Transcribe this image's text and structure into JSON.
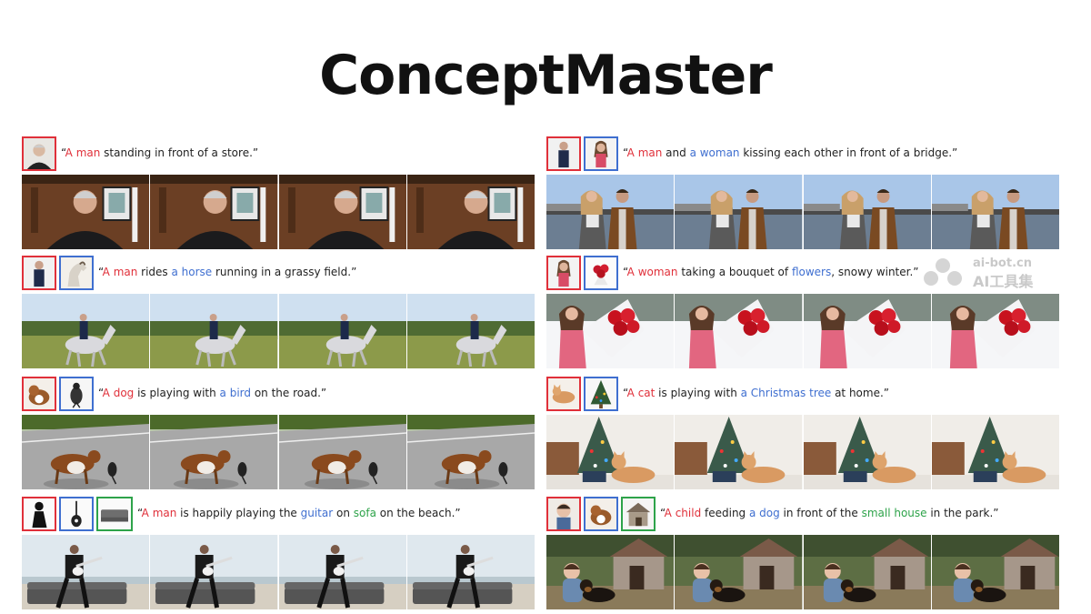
{
  "title": "ConceptMaster",
  "watermark": {
    "line1": "ai-bot.cn",
    "line2": "AI工具集"
  },
  "examples": [
    {
      "refs": [
        "man-portrait-icon"
      ],
      "caption": [
        {
          "t": "“",
          "c": ""
        },
        {
          "t": "A man",
          "c": "r"
        },
        {
          "t": " standing in front of a store.”",
          "c": ""
        }
      ],
      "scene": "store-man"
    },
    {
      "refs": [
        "man-icon",
        "horse-icon"
      ],
      "caption": [
        {
          "t": "“",
          "c": ""
        },
        {
          "t": "A man",
          "c": "r"
        },
        {
          "t": " rides ",
          "c": ""
        },
        {
          "t": "a horse",
          "c": "b"
        },
        {
          "t": " running in a grassy field.”",
          "c": ""
        }
      ],
      "scene": "horse"
    },
    {
      "refs": [
        "dog-icon",
        "bird-icon"
      ],
      "caption": [
        {
          "t": "“",
          "c": ""
        },
        {
          "t": "A dog",
          "c": "r"
        },
        {
          "t": " is playing with ",
          "c": ""
        },
        {
          "t": "a bird",
          "c": "b"
        },
        {
          "t": " on the road.”",
          "c": ""
        }
      ],
      "scene": "dog-road"
    },
    {
      "refs": [
        "man-silhouette-icon",
        "guitar-icon",
        "sofa-icon"
      ],
      "caption": [
        {
          "t": "“",
          "c": ""
        },
        {
          "t": "A man",
          "c": "r"
        },
        {
          "t": " is happily playing the ",
          "c": ""
        },
        {
          "t": "guitar",
          "c": "b"
        },
        {
          "t": " on ",
          "c": ""
        },
        {
          "t": "sofa",
          "c": "g"
        },
        {
          "t": " on the beach.”",
          "c": ""
        }
      ],
      "scene": "beach-guitar"
    },
    {
      "refs": [
        "man-icon",
        "woman-icon"
      ],
      "caption": [
        {
          "t": "“",
          "c": ""
        },
        {
          "t": "A man",
          "c": "r"
        },
        {
          "t": " and ",
          "c": ""
        },
        {
          "t": "a woman",
          "c": "b"
        },
        {
          "t": " kissing each other in front of a bridge.”",
          "c": ""
        }
      ],
      "scene": "bridge-couple"
    },
    {
      "refs": [
        "woman-icon",
        "flowers-icon"
      ],
      "caption": [
        {
          "t": "“",
          "c": ""
        },
        {
          "t": "A woman",
          "c": "r"
        },
        {
          "t": " taking a bouquet of ",
          "c": ""
        },
        {
          "t": "flowers",
          "c": "b"
        },
        {
          "t": ", snowy winter.”",
          "c": ""
        }
      ],
      "scene": "winter-flowers"
    },
    {
      "refs": [
        "cat-icon",
        "christmas-tree-icon"
      ],
      "caption": [
        {
          "t": "“",
          "c": ""
        },
        {
          "t": "A cat",
          "c": "r"
        },
        {
          "t": " is playing with ",
          "c": ""
        },
        {
          "t": "a Christmas tree",
          "c": "b"
        },
        {
          "t": " at home.”",
          "c": ""
        }
      ],
      "scene": "cat-tree"
    },
    {
      "refs": [
        "child-icon",
        "dog-icon",
        "small-house-icon"
      ],
      "caption": [
        {
          "t": "“",
          "c": ""
        },
        {
          "t": "A child",
          "c": "r"
        },
        {
          "t": " feeding ",
          "c": ""
        },
        {
          "t": "a dog",
          "c": "b"
        },
        {
          "t": " in front of the ",
          "c": ""
        },
        {
          "t": "small house",
          "c": "g"
        },
        {
          "t": " in the park.”",
          "c": ""
        }
      ],
      "scene": "park-doghouse"
    }
  ],
  "colors": {
    "red": "#e0303a",
    "blue": "#3f6fd0",
    "green": "#2ea34a"
  }
}
